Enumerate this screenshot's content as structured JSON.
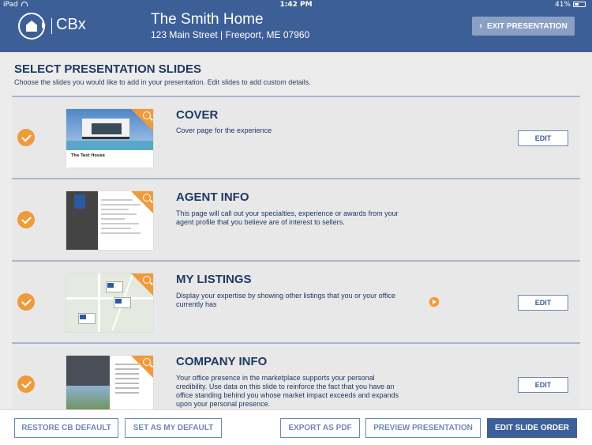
{
  "status_bar": {
    "device": "iPad",
    "time": "1:42 PM",
    "battery": "41%"
  },
  "header": {
    "logo_text": "CBx",
    "home_title": "The Smith Home",
    "home_address": "123 Main Street | Freeport, ME 07960",
    "exit_label": "EXIT PRESENTATION"
  },
  "section": {
    "title": "SELECT PRESENTATION SLIDES",
    "subtitle": "Choose the slides you would like to add in your presentation. Edit slides to add custom details."
  },
  "slides": [
    {
      "title": "COVER",
      "description": "Cover page for the experience",
      "edit_label": "EDIT",
      "thumb_caption": "The Test House"
    },
    {
      "title": "AGENT INFO",
      "description": "This page will call out your specialties, experience or awards from your agent profile that you believe are of interest to sellers.",
      "edit_label": ""
    },
    {
      "title": "MY LISTINGS",
      "description": "Display your expertise by showing other listings that you or your office currently has",
      "edit_label": "EDIT"
    },
    {
      "title": "COMPANY INFO",
      "description": "Your office presence in the marketplace supports your personal credibility. Use data on this slide to reinforce the fact that you have an office standing behind you whose market impact exceeds and expands upon your personal presence.",
      "edit_label": "EDIT"
    }
  ],
  "footer": {
    "restore_label": "RESTORE CB DEFAULT",
    "set_default_label": "SET AS MY DEFAULT",
    "export_label": "EXPORT AS PDF",
    "preview_label": "PREVIEW PRESENTATION",
    "edit_order_label": "EDIT SLIDE ORDER"
  },
  "colors": {
    "brand": "#3d5f97",
    "accent": "#ef9a3c"
  }
}
